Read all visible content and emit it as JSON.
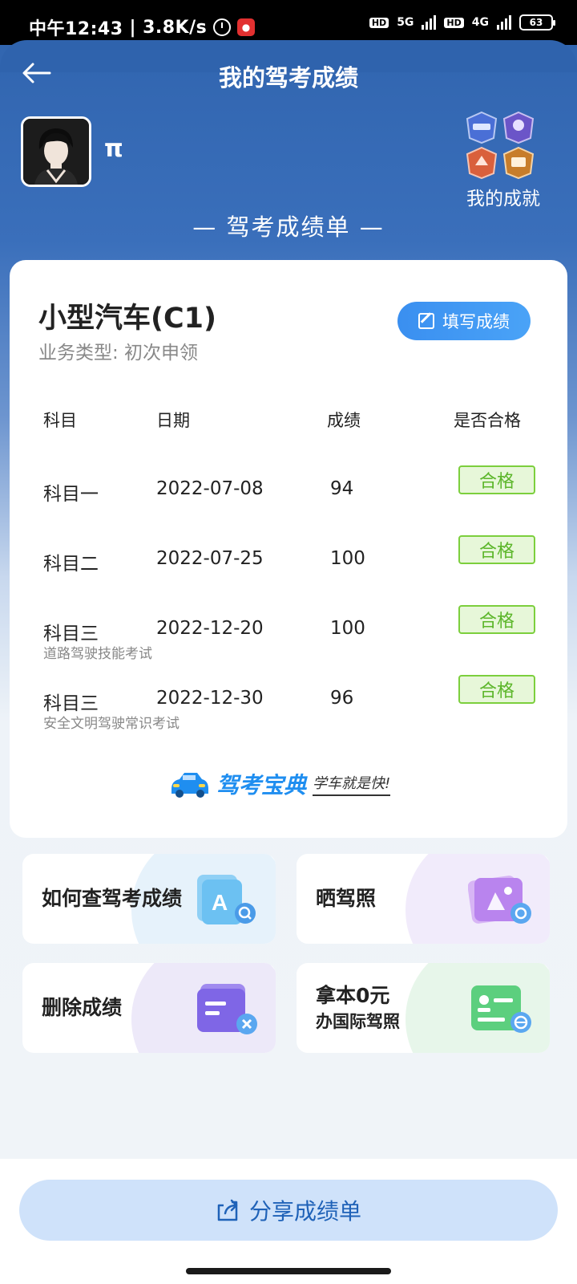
{
  "status_bar": {
    "time": "中午12:43",
    "speed": "3.8K/s",
    "net1": "5G",
    "net2": "4G",
    "hd": "HD",
    "battery": "63"
  },
  "header": {
    "title": "我的驾考成绩"
  },
  "user": {
    "name": "π"
  },
  "achievements": {
    "label": "我的成就"
  },
  "sheet": {
    "title": "— 驾考成绩单 —",
    "license_type": "小型汽车(C1)",
    "business_type": "业务类型: 初次申领",
    "fill_button": "填写成绩",
    "columns": [
      "科目",
      "日期",
      "成绩",
      "是否合格"
    ],
    "rows": [
      {
        "subject": "科目一",
        "sub": "",
        "date": "2022-07-08",
        "score": "94",
        "status": "合格"
      },
      {
        "subject": "科目二",
        "sub": "",
        "date": "2022-07-25",
        "score": "100",
        "status": "合格"
      },
      {
        "subject": "科目三",
        "sub": "道路驾驶技能考试",
        "date": "2022-12-20",
        "score": "100",
        "status": "合格"
      },
      {
        "subject": "科目三",
        "sub": "安全文明驾驶常识考试",
        "date": "2022-12-30",
        "score": "96",
        "status": "合格"
      }
    ],
    "brand_name": "驾考宝典",
    "brand_slogan": "学车就是快!"
  },
  "tiles": [
    {
      "line1": "如何查驾考成绩",
      "line2": "",
      "icon": "search-doc-icon",
      "color": "#e6f2fb"
    },
    {
      "line1": "晒驾照",
      "line2": "",
      "icon": "photo-icon",
      "color": "#f1ebfb"
    },
    {
      "line1": "删除成绩",
      "line2": "",
      "icon": "delete-doc-icon",
      "color": "#ede9f9"
    },
    {
      "line1": "拿本0元",
      "line2": "办国际驾照",
      "icon": "intl-license-icon",
      "color": "#e7f6ea"
    }
  ],
  "footer": {
    "share_label": "分享成绩单"
  },
  "colors": {
    "primary": "#2f63ad",
    "pass_green": "#7ccf3d",
    "button_blue": "#3a8ff0"
  }
}
